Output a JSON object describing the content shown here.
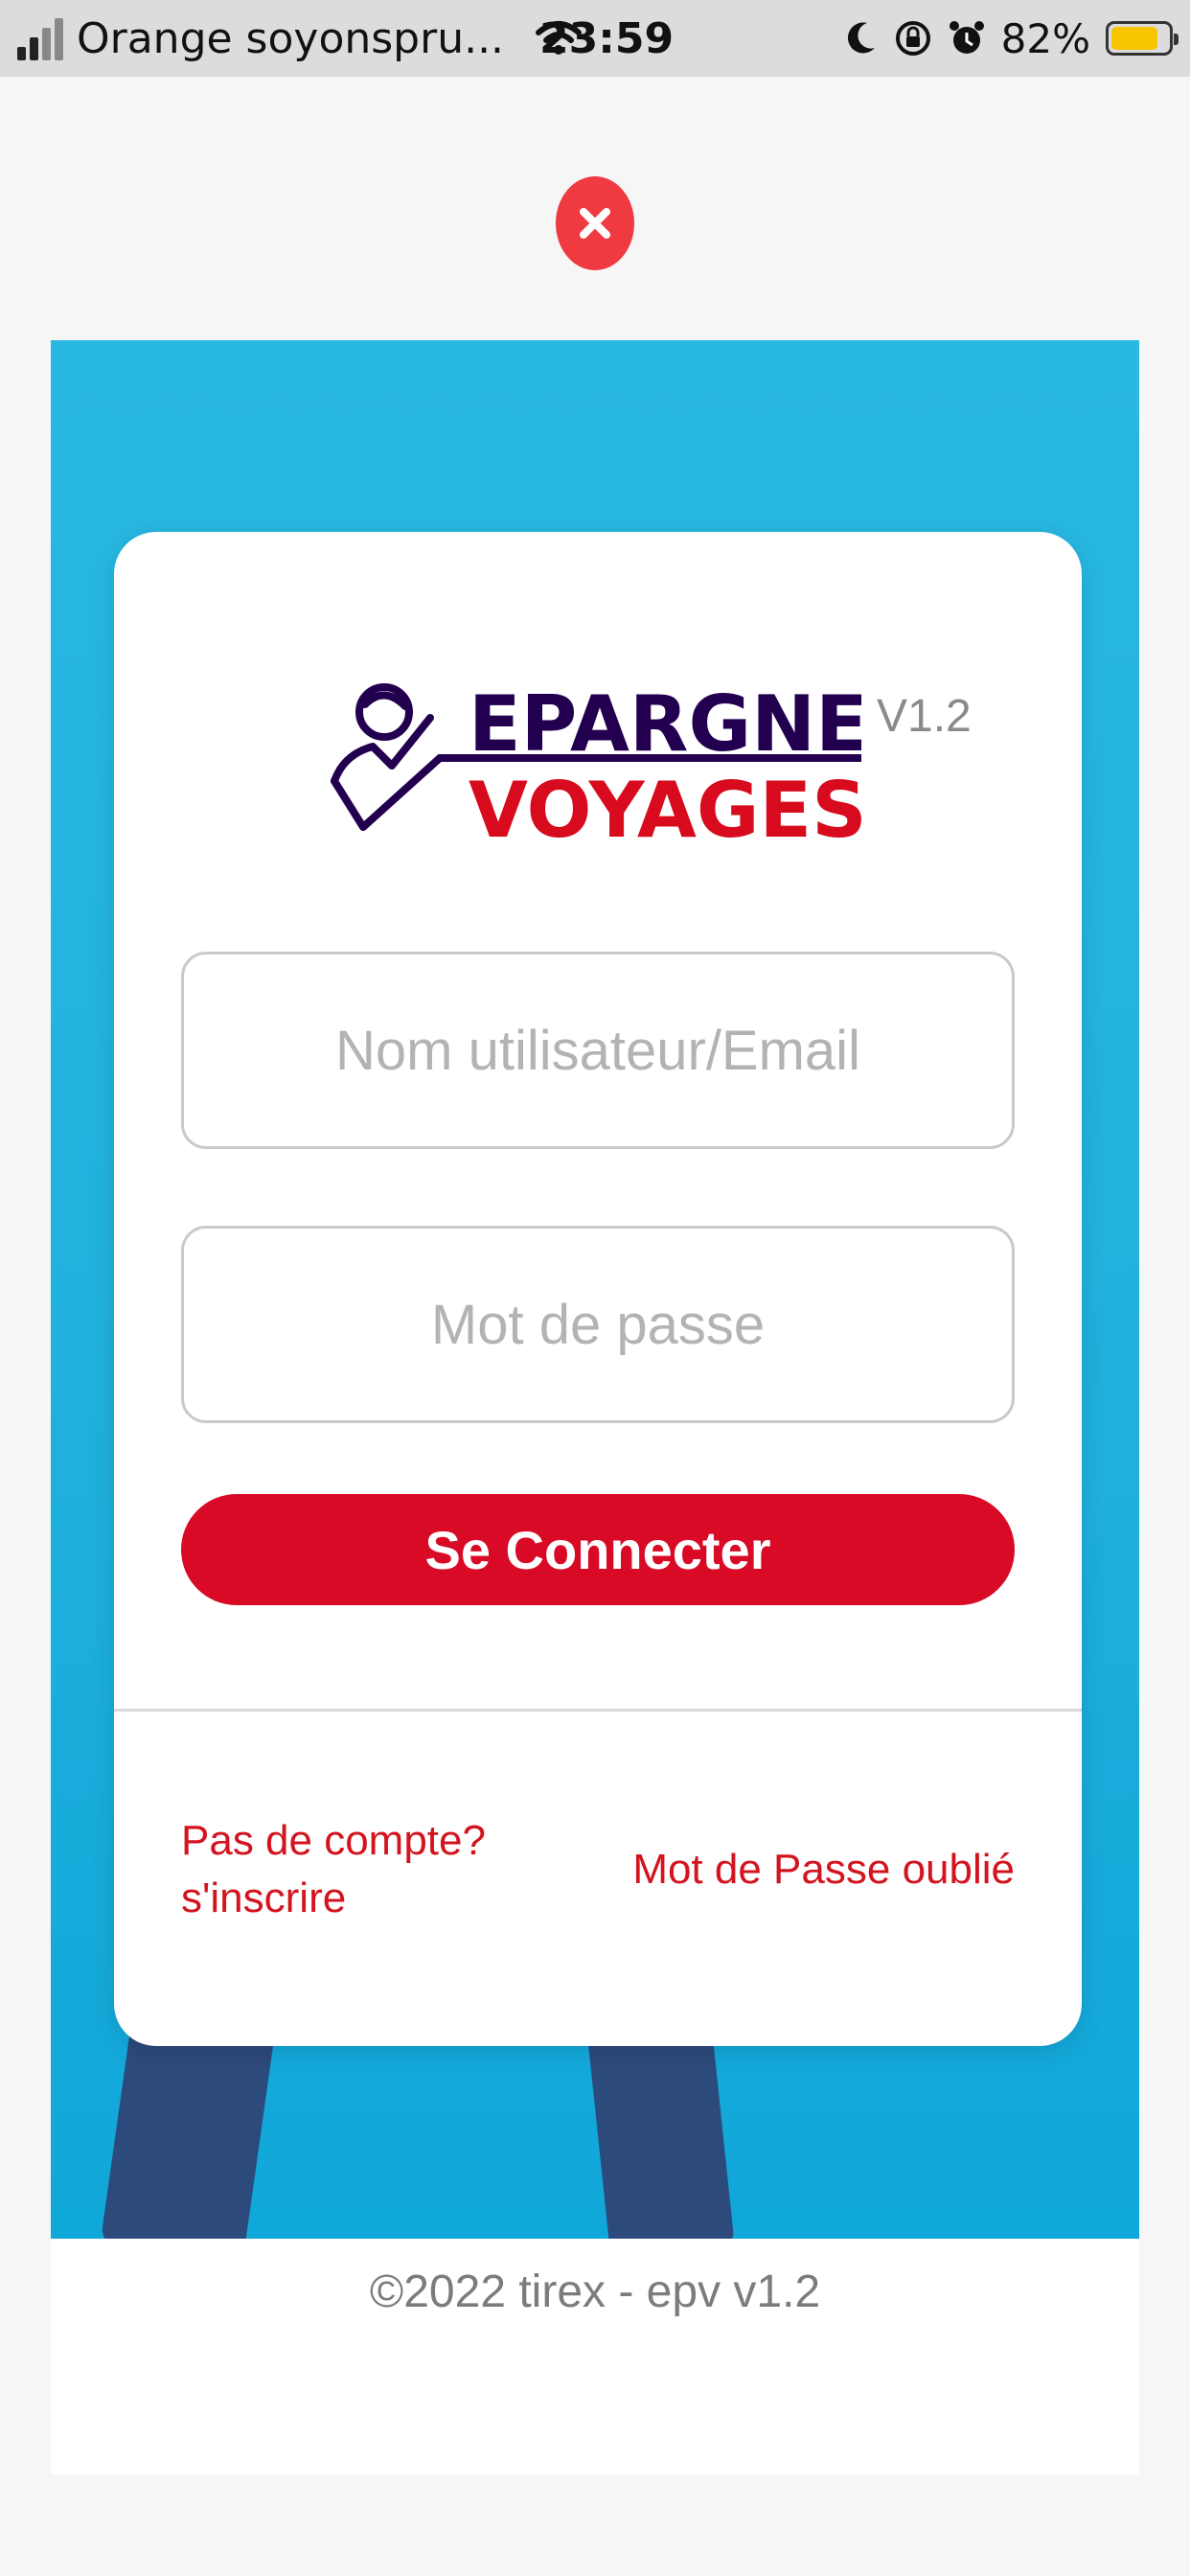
{
  "status_bar": {
    "carrier": "Orange soyonspru...",
    "time": "23:59",
    "battery": "82%",
    "battery_level": 0.82
  },
  "close_button": {
    "icon": "close-icon"
  },
  "card": {
    "logo": {
      "line1": "EPARGNE",
      "line2": "VOYAGES",
      "line1_color": "#23004f",
      "line2_color": "#d80a1e"
    },
    "version": "V1.2",
    "username_placeholder": "Nom utilisateur/Email",
    "password_placeholder": "Mot de passe",
    "login_button": "Se Connecter",
    "signup_line1": "Pas de compte?",
    "signup_line2": "s'inscrire",
    "forgot_password": "Mot de Passe oublié"
  },
  "footer": {
    "text": "©2022 tirex - epv v1.2"
  },
  "colors": {
    "accent": "#d80a26",
    "hero": "#22b4e0",
    "close": "#ef3a41"
  }
}
